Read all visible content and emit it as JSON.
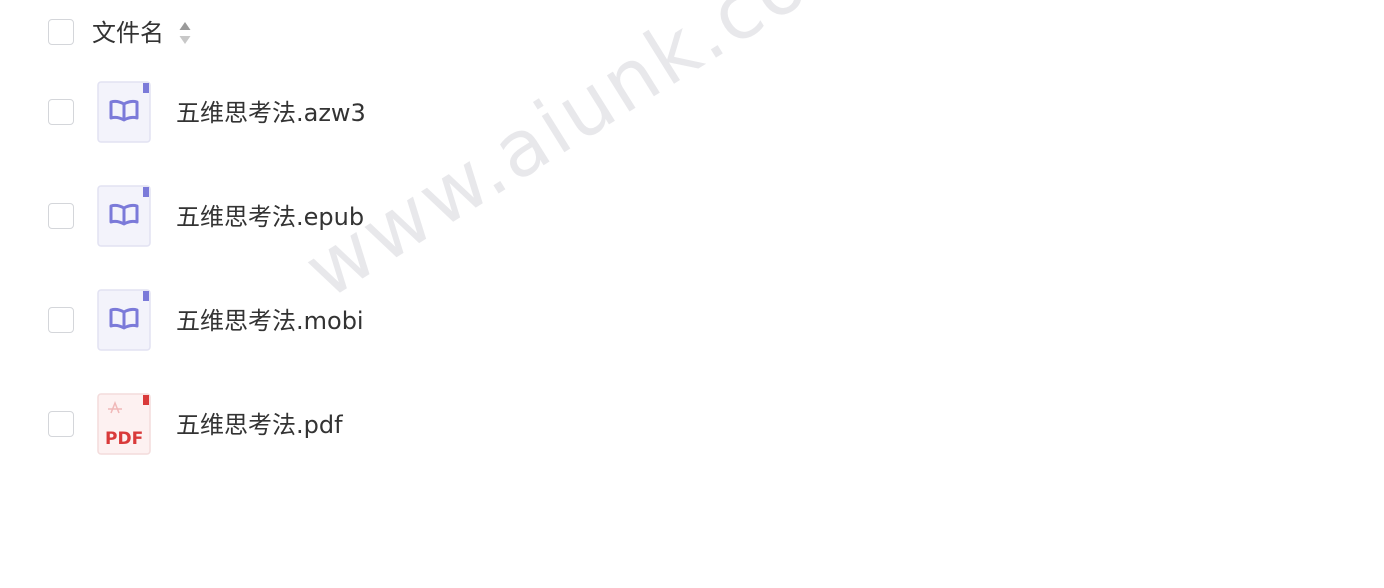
{
  "header": {
    "column_label": "文件名",
    "sort_icon": "sort-updown-icon"
  },
  "files": [
    {
      "name": "五维思考法.azw3",
      "icon": "ebook-icon"
    },
    {
      "name": "五维思考法.epub",
      "icon": "ebook-icon"
    },
    {
      "name": "五维思考法.mobi",
      "icon": "ebook-icon"
    },
    {
      "name": "五维思考法.pdf",
      "icon": "pdf-icon",
      "icon_text": "PDF"
    }
  ],
  "watermark": {
    "text": "www.aiunk.com"
  },
  "colors": {
    "ebook_accent": "#7b7ad9",
    "ebook_bg": "#f3f3fb",
    "pdf_accent": "#d93a3a",
    "pdf_bg": "#fdf1f1",
    "checkbox_border": "#d4d6da"
  }
}
